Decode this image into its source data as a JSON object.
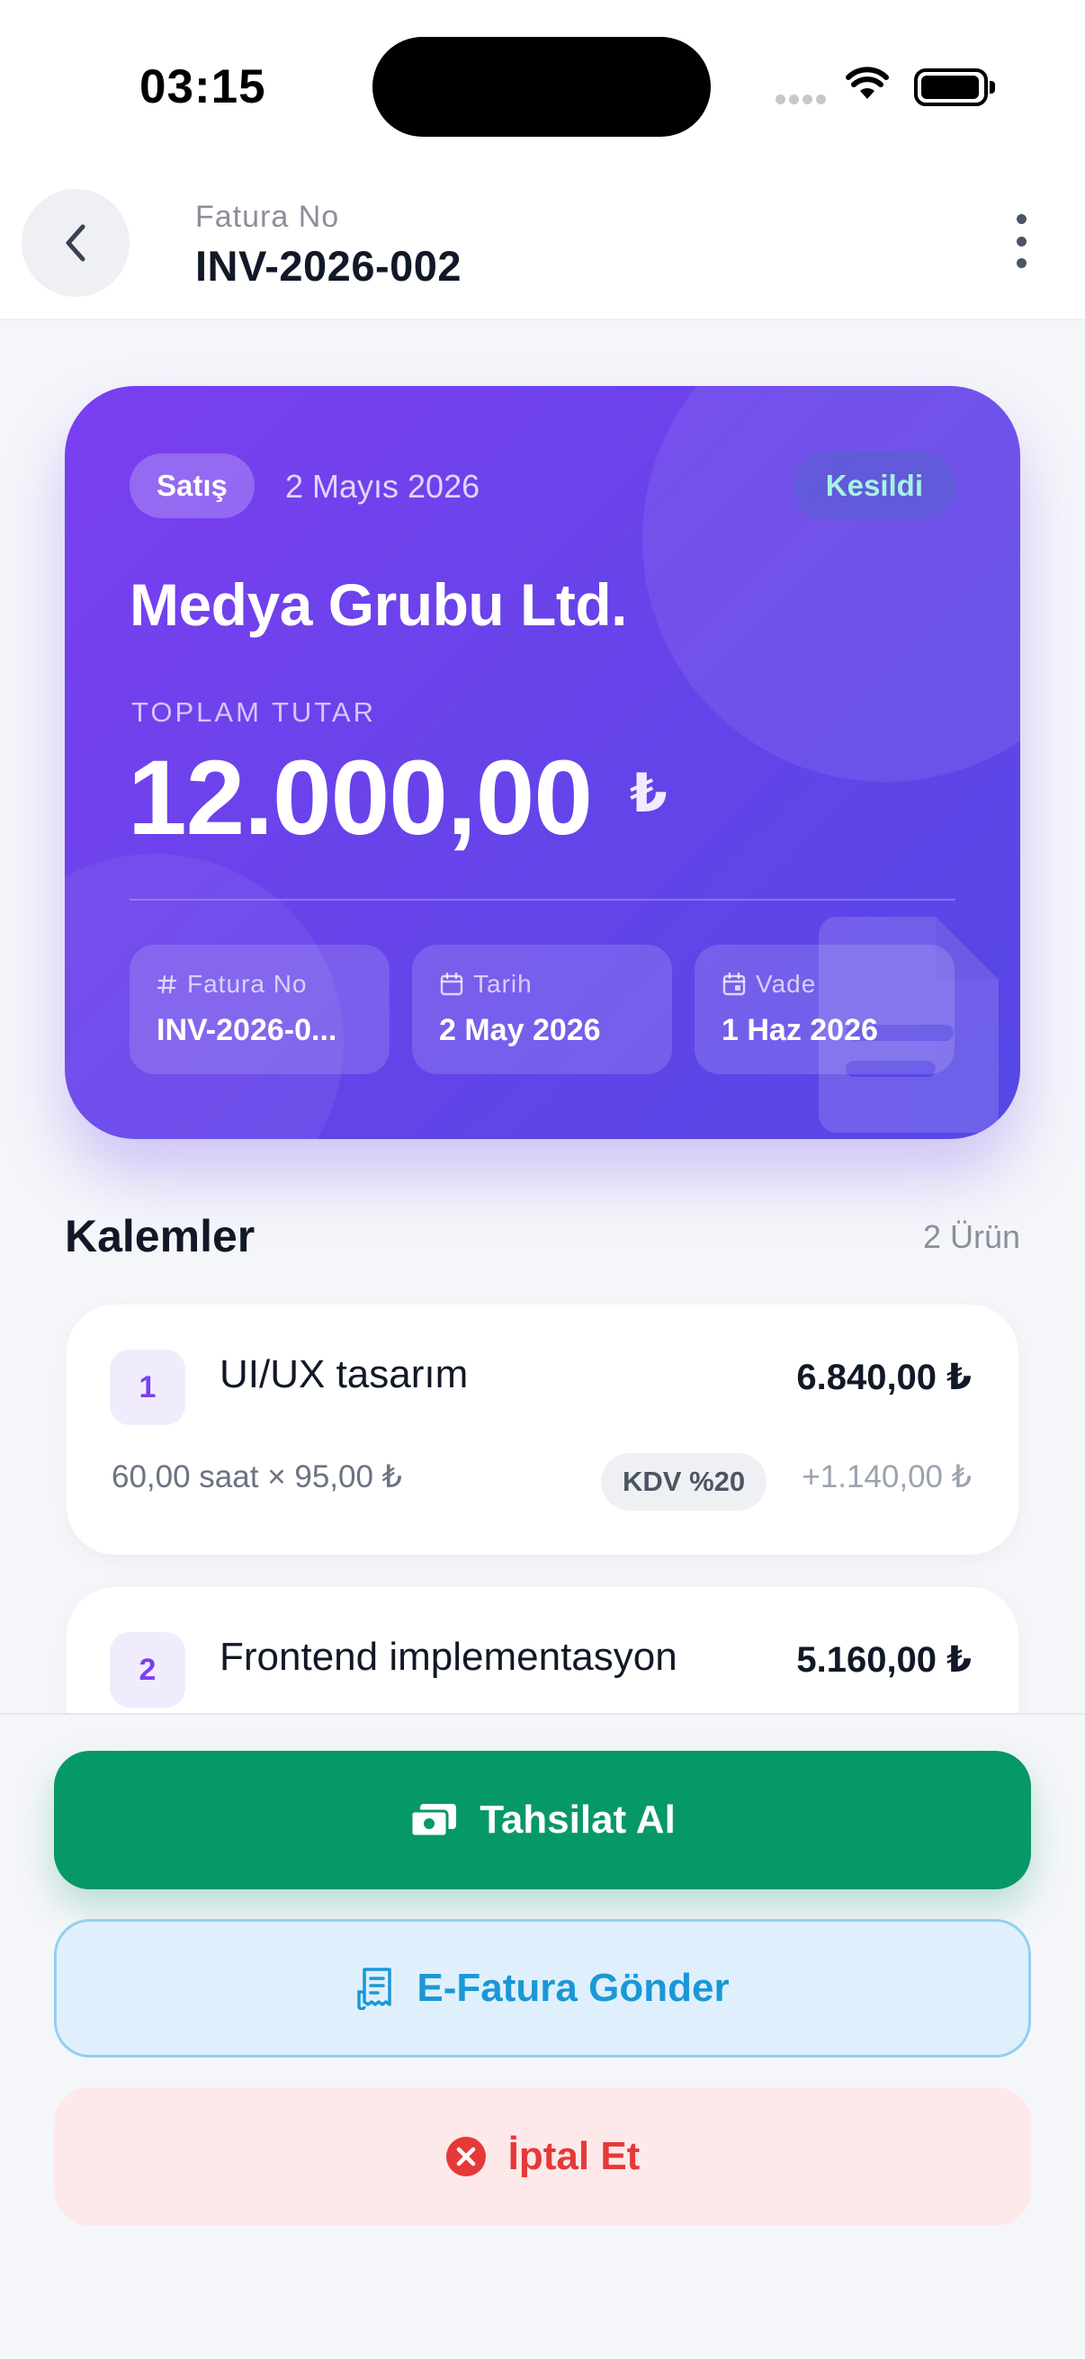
{
  "status_bar": {
    "time": "03:15"
  },
  "header": {
    "label": "Fatura No",
    "title": "INV-2026-002",
    "back_icon": "chevron-left-icon",
    "more_icon": "more-vertical-icon"
  },
  "hero": {
    "type_badge": "Satış",
    "date": "2 Mayıs 2026",
    "status_badge": "Kesildi",
    "customer": "Medya Grubu Ltd.",
    "total_label": "TOPLAM TUTAR",
    "total_amount": "12.000,00",
    "currency": "₺",
    "info": [
      {
        "icon": "hash-icon",
        "label": "Fatura No",
        "value": "INV-2026-0..."
      },
      {
        "icon": "calendar-icon",
        "label": "Tarih",
        "value": "2 May 2026"
      },
      {
        "icon": "calendar-due-icon",
        "label": "Vade",
        "value": "1 Haz 2026"
      }
    ],
    "colors": {
      "gradient_start": "#7b3ff0",
      "gradient_end": "#5547e6",
      "status_text": "#a7f3e0"
    }
  },
  "items_section": {
    "title": "Kalemler",
    "count": "2 Ürün",
    "items": [
      {
        "index": "1",
        "name": "UI/UX tasarım",
        "amount": "6.840,00 ₺",
        "quantity": "60,00 saat × 95,00 ₺",
        "kdv": "KDV %20",
        "kdv_amount": "+1.140,00 ₺"
      },
      {
        "index": "2",
        "name": "Frontend implementasyon",
        "amount": "5.160,00 ₺"
      }
    ]
  },
  "actions": {
    "collect": {
      "label": "Tahsilat Al",
      "icon": "cash-icon",
      "color": "#079868"
    },
    "einvoice": {
      "label": "E-Fatura Gönder",
      "icon": "receipt-icon",
      "color": "#1b97d6"
    },
    "cancel": {
      "label": "İptal Et",
      "icon": "x-circle-icon",
      "color": "#e53939"
    }
  }
}
